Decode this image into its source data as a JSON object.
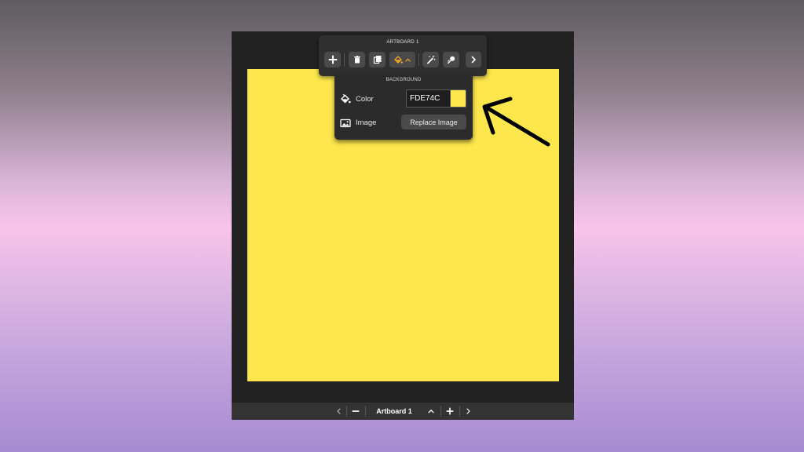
{
  "colors": {
    "canvas_fill": "#FDE74C",
    "accent": "#f5a623",
    "icon": "#ffffff"
  },
  "toolbar": {
    "title": "ARTBOARD 1",
    "buttons": [
      {
        "icon": "plus-icon"
      },
      {
        "icon": "trash-icon"
      },
      {
        "icon": "duplicate-icon"
      },
      {
        "icon": "paint-bucket-icon",
        "active": true
      },
      {
        "icon": "magic-wand-icon"
      },
      {
        "icon": "magic-brush-icon"
      },
      {
        "icon": "chevron-right-icon"
      }
    ]
  },
  "background_panel": {
    "title": "BACKGROUND",
    "color_label": "Color",
    "color_value": "FDE74C",
    "image_label": "Image",
    "replace_label": "Replace Image"
  },
  "bottom_bar": {
    "artboard_name": "Artboard 1"
  }
}
